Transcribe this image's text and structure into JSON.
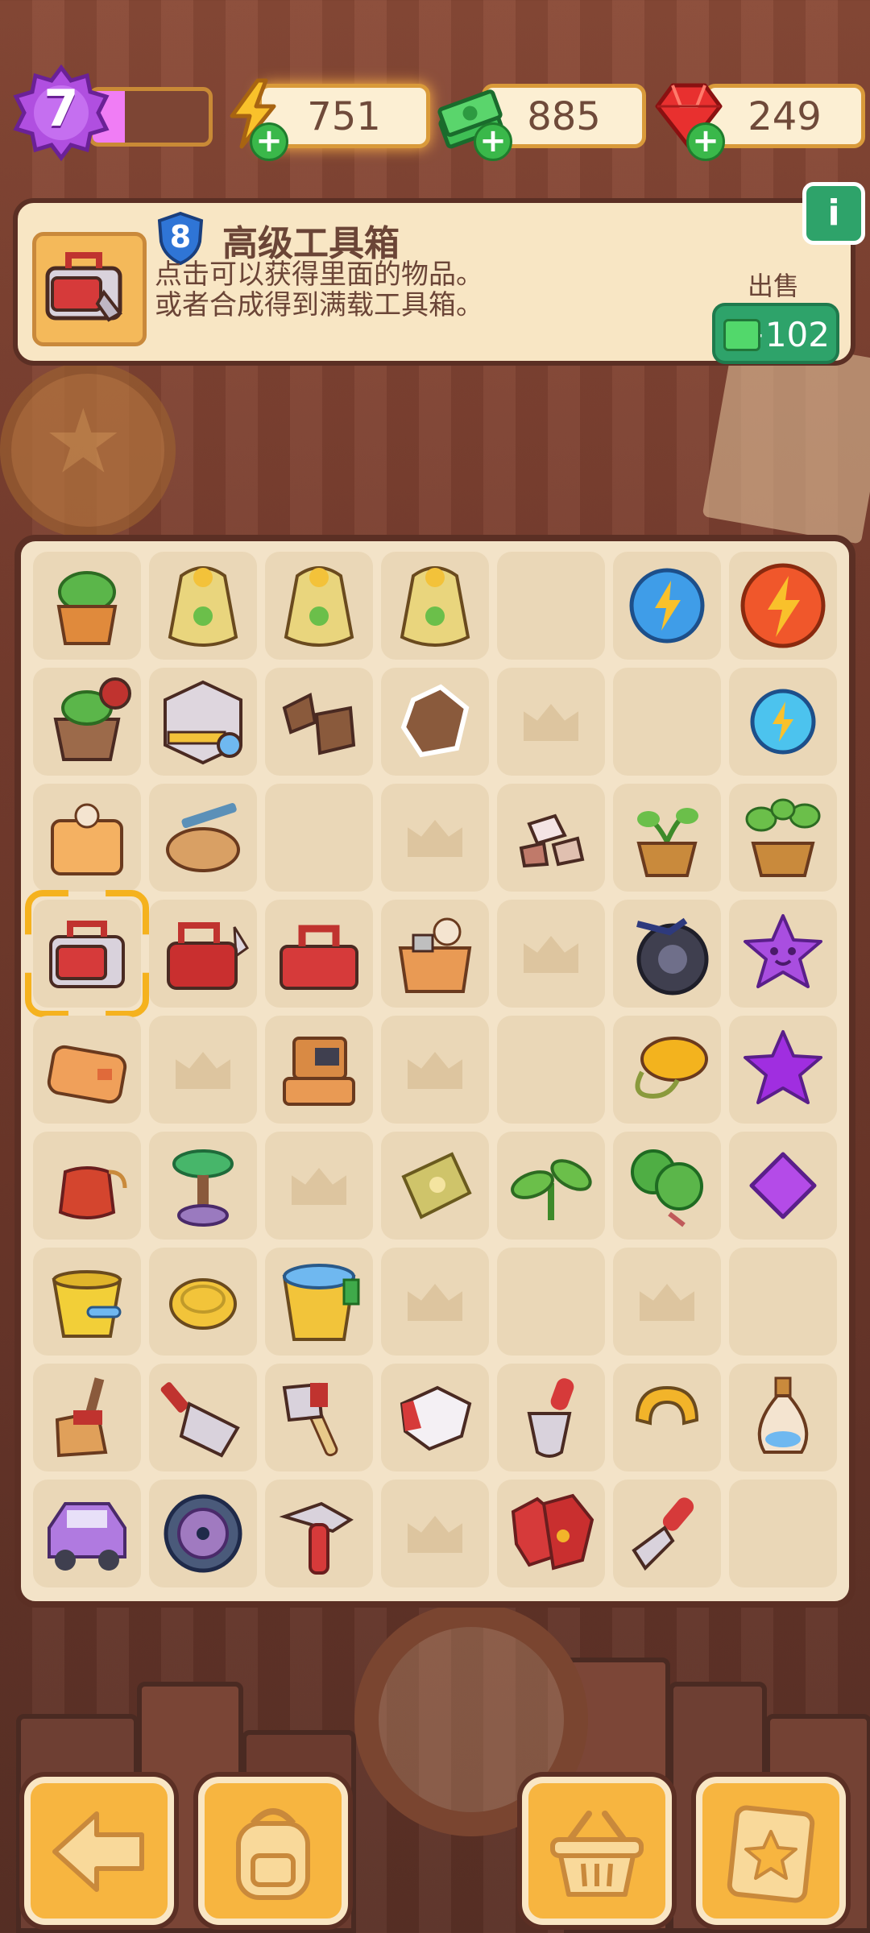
{
  "top_bar": {
    "level": "7",
    "xp_progress": 0.28,
    "energy": "751",
    "cash": "885",
    "gems": "249",
    "icons": {
      "energy": "lightning-icon",
      "cash": "cash-stack-icon",
      "gems": "ruby-icon",
      "add": "plus-icon"
    }
  },
  "info_panel": {
    "item_level": "8",
    "item_name": "高级工具箱",
    "description_line1": "点击可以获得里面的物品。",
    "description_line2": "或者合成得到满载工具箱。",
    "sell_label": "出售",
    "sell_value": "+102",
    "info_icon": "i"
  },
  "board": {
    "columns": 7,
    "rows": 9,
    "cells": [
      "potted-bush",
      "seed-sack",
      "seed-sack",
      "seed-sack",
      "empty",
      "energy-orb-blue",
      "energy-orb-red",
      "cauldron-plant",
      "locked-crate",
      "broken-pieces",
      "cookie-fragment",
      "locked",
      "empty",
      "energy-orb-small",
      "bread-box",
      "tool-bench",
      "empty",
      "locked",
      "rock-pieces",
      "sprout-pot",
      "plant-pot",
      "advanced-toolbox",
      "winged-toolbox",
      "red-toolbox",
      "open-box",
      "locked",
      "folding-bike",
      "purple-star-face",
      "wallet",
      "locked",
      "box-stack",
      "locked",
      "empty",
      "yellow-bag",
      "purple-star",
      "pouch",
      "bonsai-tree",
      "locked",
      "seed-packet",
      "leaf-sprout",
      "leafy-branch",
      "purple-gem",
      "bucket",
      "coil-rope",
      "bucket-full",
      "locked",
      "empty",
      "locked",
      "empty",
      "broom",
      "rake",
      "axe",
      "glove",
      "trowel",
      "horseshoe",
      "vase",
      "purple-car",
      "wheel",
      "hammer",
      "locked",
      "red-gloves",
      "spatula",
      "empty"
    ],
    "selected_index": 21
  },
  "bottom_bar": {
    "buttons": [
      "back-arrow-icon",
      "backpack-icon",
      "basket-icon",
      "clipboard-star-icon"
    ]
  },
  "colors": {
    "accent": "#f7b540",
    "sell_green": "#2ea36a",
    "energy_orange": "#f28b1f",
    "cash_green": "#3ab84a",
    "gem_red": "#e8302f",
    "level_purple": "#b04fe0"
  }
}
